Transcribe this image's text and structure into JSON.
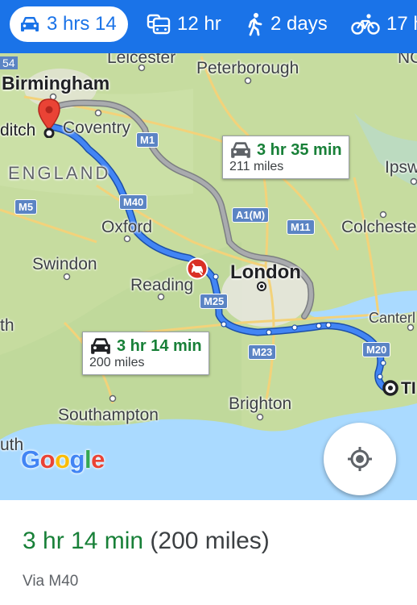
{
  "travel_modes": [
    {
      "icon": "car-icon",
      "label": "3 hrs 14",
      "active": true
    },
    {
      "icon": "bus-icon",
      "label": "12 hr",
      "active": false
    },
    {
      "icon": "walk-icon",
      "label": "2 days",
      "active": false
    },
    {
      "icon": "bike-icon",
      "label": "17 h",
      "active": false
    }
  ],
  "map": {
    "places": {
      "leicester": "Leicester",
      "peterborough": "Peterborough",
      "birmingham": "Birmingham",
      "redditch": "ditch",
      "coventry": "Coventry",
      "england": "ENGLAND",
      "ipswich": "Ipsw",
      "colchester": "Colcheste",
      "oxford": "Oxford",
      "swindon": "Swindon",
      "reading": "Reading",
      "london": "London",
      "canterbury": "Canterl",
      "th": "th",
      "southampton": "Southampton",
      "brighton": "Brighton",
      "uth": "uth",
      "no": "NC",
      "destination": "TI",
      "left54": "54"
    },
    "roads": {
      "m1": "M1",
      "m40": "M40",
      "m5": "M5",
      "a1m": "A1(M)",
      "m11": "M11",
      "m25": "M25",
      "m23": "M23",
      "m20": "M20"
    },
    "alt_route": {
      "time": "3 hr 35 min",
      "distance": "211 miles"
    },
    "main_route": {
      "time": "3 hr 14 min",
      "distance": "200 miles"
    },
    "logo": "Google"
  },
  "summary": {
    "time": "3 hr 14 min",
    "distance": "(200 miles)",
    "via": "Via M40"
  },
  "colors": {
    "primary": "#1a73e8",
    "route": "#4285f4",
    "alt_route": "#9aa0a6",
    "time_green": "#188038",
    "sea": "#aadaff",
    "land": "#c6dc9f"
  }
}
